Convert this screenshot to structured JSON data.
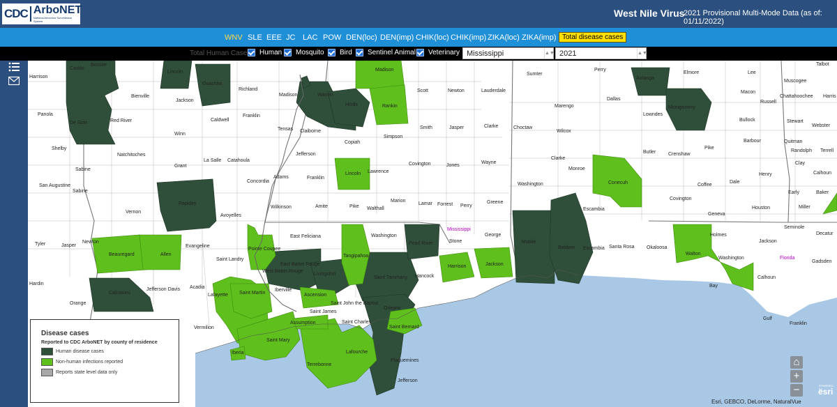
{
  "header": {
    "logo_cdc": "CDC",
    "logo_name": "ArboNET",
    "logo_sub": "National Arbovirus Surveillance System",
    "title": "West Nile Virus",
    "subtitle": "2021 Provisional Multi-Mode Data (as of: 01/11/2022)"
  },
  "tabs": [
    {
      "label": "WNV",
      "active": true
    },
    {
      "label": "SLE"
    },
    {
      "label": "EEE"
    },
    {
      "label": "JC"
    },
    {
      "label": "LAC"
    },
    {
      "label": "POW"
    },
    {
      "label": "DEN(loc)"
    },
    {
      "label": "DEN(imp)"
    },
    {
      "label": "CHIK(loc)"
    },
    {
      "label": "CHIK(imp)"
    },
    {
      "label": "ZIKA(loc)"
    },
    {
      "label": "ZIKA(imp)"
    },
    {
      "label": "Total disease cases"
    }
  ],
  "filters": {
    "ghost_label": "Total Human Cases",
    "checkboxes": [
      "Human",
      "Mosquito",
      "Bird",
      "Sentinel Animal",
      "Veterinary"
    ],
    "state_select": "Mississippi",
    "year_select": "2021"
  },
  "legend": {
    "title": "Disease cases",
    "subtitle": "Reported to CDC ArboNET by county of residence",
    "items": [
      {
        "label": "Human disease cases",
        "color": "#2f4f3a"
      },
      {
        "label": "Non-human infections reported",
        "color": "#5fbf1c"
      },
      {
        "label": "Reports state level data only",
        "color": "#a8a8a8"
      }
    ]
  },
  "map": {
    "colors": {
      "human": "#2f4f3a",
      "nonhuman": "#5fbf1c",
      "none": "#ffffff",
      "water": "#a9c8e6"
    },
    "states": [
      "Mississippi",
      "Florida"
    ],
    "counties": [
      "Harrison",
      "Bossier",
      "Caddo",
      "Lincoln",
      "Ouachita",
      "Richland",
      "Madison",
      "Warren",
      "Hinds",
      "Rankin",
      "Scott",
      "Newton",
      "Lauderdale",
      "Sumter",
      "Perry",
      "Autauga",
      "Elmore",
      "Lee",
      "Talbot",
      "Panola",
      "Bienville",
      "Jackson",
      "Franklin",
      "Tensas",
      "Claiborne",
      "Copiah",
      "Simpson",
      "Smith",
      "Jasper",
      "Clarke",
      "Choctaw",
      "Marengo",
      "Dallas",
      "Lowndes",
      "Montgomery",
      "Macon",
      "Russell",
      "Muscogee",
      "Chattahoochee",
      "Harris",
      "Stewart",
      "Webster",
      "De Soto",
      "Red River",
      "Winn",
      "Caldwell",
      "Shelby",
      "Natchitoches",
      "Grant",
      "La Salle",
      "Catahoula",
      "Concordia",
      "Adams",
      "Jefferson",
      "Lincoln",
      "Lawrence",
      "Covington",
      "Jones",
      "Wayne",
      "Washington",
      "Monroe",
      "Conecuh",
      "Butler",
      "Crenshaw",
      "Pike",
      "Coffee",
      "Dale",
      "Henry",
      "Barbour",
      "Bullock",
      "Quitman",
      "Randolph",
      "Clay",
      "Terrell",
      "Calhoun",
      "Early",
      "Baker",
      "Miller",
      "San Augustine",
      "Sabine",
      "Sabine",
      "Vernon",
      "Rapides",
      "Avoyelles",
      "Wilkinson",
      "Amite",
      "Pike",
      "Walthall",
      "Marion",
      "Lamar",
      "Forrest",
      "Perry",
      "Greene",
      "Escambia",
      "Covington",
      "Geneva",
      "Houston",
      "Seminole",
      "Decatur",
      "Tyler",
      "Jasper",
      "Newton",
      "Beauregard",
      "Allen",
      "Evangeline",
      "Pointe Coupee",
      "West Baton Rouge",
      "East Feliciana",
      "Washington",
      "Pearl River",
      "Stone",
      "George",
      "Mobile",
      "Baldwin",
      "Escambia",
      "Santa Rosa",
      "Okaloosa",
      "Walton",
      "Holmes",
      "Jackson",
      "Gadsden",
      "Saint Landry",
      "East Baton Rouge",
      "Livingston",
      "Tangipahoa",
      "Saint Tammany",
      "Hancock",
      "Harrison",
      "Jackson",
      "Washington",
      "Calhoun",
      "Bay",
      "Hardin",
      "Calcasieu",
      "Jefferson Davis",
      "Acadia",
      "Lafayette",
      "Saint Martin",
      "Iberville",
      "Ascension",
      "Saint John the Baptist",
      "Orleans",
      "Saint Bernard",
      "Saint James",
      "Saint Charles",
      "Assumption",
      "Orange",
      "Vermilion",
      "Iberia",
      "Saint Mary",
      "Terrebonne",
      "Lafourche",
      "Gulf",
      "Franklin",
      "Plaquemines",
      "Jefferson"
    ],
    "attribution": "Esri, GEBCO, DeLorme, NaturalVue",
    "esri_label": "esri",
    "esri_small": "POWERED BY"
  }
}
